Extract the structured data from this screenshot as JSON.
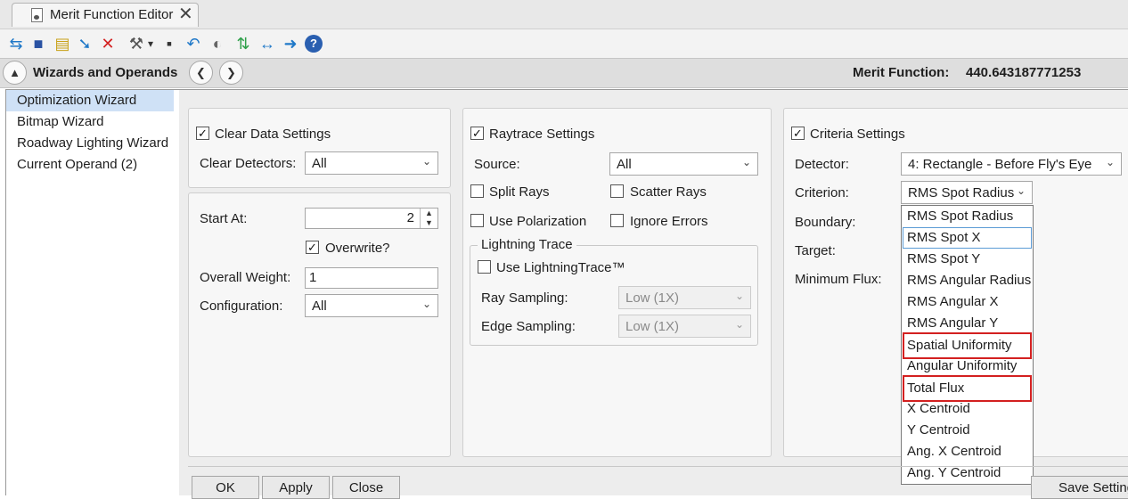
{
  "tab": {
    "title": "Merit Function Editor",
    "close_glyph": "✕",
    "icon": "document-icon"
  },
  "toolbar": {
    "icons": [
      "refresh-icon",
      "save-icon",
      "load-icon",
      "insert-operand-icon",
      "delete-icon",
      "wizard-tools-icon",
      "dropdown-caret-icon",
      "calculator-icon",
      "undo-icon",
      "toggle-icon",
      "swap-icon",
      "compress-icon",
      "arrow-right-icon",
      "help-icon"
    ],
    "glyphs": {
      "refresh": "⇆",
      "save": "■",
      "load": "▤",
      "insert": "➘",
      "delete": "✕",
      "wizard": "⚒",
      "caret": "▾",
      "calc": "▪",
      "undo": "↶",
      "toggle": "◐",
      "swap": "⇅",
      "compress": "↔",
      "arrow": "➜",
      "help": "?"
    }
  },
  "header": {
    "title": "Wizards and Operands",
    "collapse_glyph": "▲",
    "prev_glyph": "❮",
    "next_glyph": "❯",
    "merit_label": "Merit Function:",
    "merit_value": "440.643187771253"
  },
  "nav": {
    "items": [
      {
        "label": "Optimization Wizard",
        "selected": true
      },
      {
        "label": "Bitmap Wizard",
        "selected": false
      },
      {
        "label": "Roadway Lighting Wizard",
        "selected": false
      },
      {
        "label": "Current Operand (2)",
        "selected": false
      }
    ]
  },
  "clear_data": {
    "checkbox_label": "Clear Data Settings",
    "checked": true,
    "detectors_label": "Clear Detectors:",
    "detectors_value": "All"
  },
  "general": {
    "start_at_label": "Start At:",
    "start_at_value": "2",
    "overwrite_label": "Overwrite?",
    "overwrite_checked": true,
    "weight_label": "Overall Weight:",
    "weight_value": "1",
    "config_label": "Configuration:",
    "config_value": "All"
  },
  "raytrace": {
    "checkbox_label": "Raytrace Settings",
    "checked": true,
    "source_label": "Source:",
    "source_value": "All",
    "split_rays": "Split Rays",
    "scatter_rays": "Scatter Rays",
    "use_polarization": "Use Polarization",
    "ignore_errors": "Ignore Errors",
    "lightning_group": "Lightning Trace",
    "use_lightning": "Use LightningTrace™",
    "ray_sampling_label": "Ray Sampling:",
    "ray_sampling_value": "Low (1X)",
    "edge_sampling_label": "Edge Sampling:",
    "edge_sampling_value": "Low (1X)"
  },
  "criteria": {
    "checkbox_label": "Criteria Settings",
    "checked": true,
    "detector_label": "Detector:",
    "detector_value": "4: Rectangle - Before Fly's Eye",
    "criterion_label": "Criterion:",
    "criterion_value": "RMS Spot Radius",
    "boundary_label": "Boundary:",
    "target_label": "Target:",
    "min_flux_label": "Minimum Flux:",
    "options": [
      {
        "label": "RMS Spot Radius",
        "state": "normal"
      },
      {
        "label": "RMS Spot X",
        "state": "hover"
      },
      {
        "label": "RMS Spot Y",
        "state": "normal"
      },
      {
        "label": "RMS Angular Radius",
        "state": "normal"
      },
      {
        "label": "RMS Angular X",
        "state": "normal"
      },
      {
        "label": "RMS Angular Y",
        "state": "normal"
      },
      {
        "label": "Spatial Uniformity",
        "state": "flag"
      },
      {
        "label": "Angular Uniformity",
        "state": "normal"
      },
      {
        "label": "Total Flux",
        "state": "flag"
      },
      {
        "label": "X Centroid",
        "state": "normal"
      },
      {
        "label": "Y Centroid",
        "state": "normal"
      },
      {
        "label": "Ang. X Centroid",
        "state": "normal"
      },
      {
        "label": "Ang. Y Centroid",
        "state": "normal"
      }
    ]
  },
  "buttons": {
    "ok": "OK",
    "apply": "Apply",
    "close": "Close",
    "save_settings": "Save Settings"
  },
  "glyphs": {
    "check": "✓",
    "combo_arrow": "⌄",
    "spin_up": "▲",
    "spin_down": "▼"
  },
  "colors": {
    "flag_border": "#d32020",
    "hover_border": "#5b9bd5",
    "selected_nav": "#cfe1f6"
  }
}
